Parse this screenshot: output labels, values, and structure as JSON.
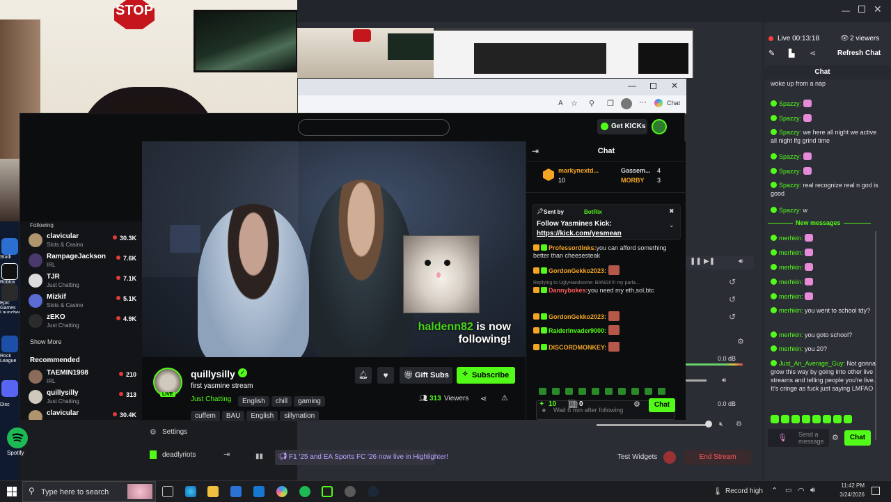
{
  "obs": {
    "live_time": "Live 00:13:18",
    "viewers": "2 viewers",
    "refresh_chat": "Refresh Chat",
    "chat_title": "Chat",
    "new_messages": "New messages",
    "test_widgets": "Test Widgets",
    "end_stream": "End Stream",
    "settings": "Settings",
    "account": "deadlyriots",
    "highlighter_banner": "F1 '25 and EA Sports FC '26 now live in Highlighter!",
    "db_values": [
      "0.0 dB",
      "0.0 dB",
      "0.0 dB"
    ],
    "send_placeholder": "Send a message",
    "chat_button": "Chat",
    "dock_messages": [
      {
        "user": "",
        "text": "woke up from a nap",
        "emote": false
      },
      {
        "user": "Spazzy:",
        "text": "",
        "emote": true
      },
      {
        "user": "Spazzy:",
        "text": "",
        "emote": true
      },
      {
        "user": "Spazzy:",
        "text": "we here all night we active all night lfg grind time",
        "emote": false
      },
      {
        "user": "Spazzy:",
        "text": "",
        "emote": true
      },
      {
        "user": "Spazzy:",
        "text": "",
        "emote": true
      },
      {
        "user": "Spazzy:",
        "text": "real recognize real n god is good",
        "emote": false
      },
      {
        "user": "Spazzy:",
        "text": "w",
        "emote": false
      }
    ],
    "dock_new": [
      {
        "user": "merhkin:",
        "text": "",
        "emote": true
      },
      {
        "user": "merhkin:",
        "text": "",
        "emote": true
      },
      {
        "user": "merhkin:",
        "text": "",
        "emote": true
      },
      {
        "user": "merhkin:",
        "text": "",
        "emote": true
      },
      {
        "user": "merhkin:",
        "text": "",
        "emote": true
      },
      {
        "user": "merhkin:",
        "text": "you went to school tdy?",
        "emote": false
      },
      {
        "user": "merhkin:",
        "text": "you goto school?",
        "emote": false
      },
      {
        "user": "merhkin:",
        "text": "you 20?",
        "emote": false
      },
      {
        "user": "Just_An_Average_Guy:",
        "text": "Not gonna grow this way by going into other live streams and telling people you're live. It's cringe as fuck just saying LMFAO",
        "emote": false
      }
    ]
  },
  "desktop": {
    "icons": [
      "Studi",
      "Roblox",
      "Epic Games Launcher",
      "Rock League",
      "Disc",
      "Spotify"
    ],
    "stop_sign": "STOP"
  },
  "browser": {
    "chat_label": "Chat"
  },
  "kick": {
    "get_kicks": "Get KICKs",
    "following_label": "Following",
    "following": [
      {
        "name": "clavicular",
        "cat": "Slots & Casino",
        "count": "30.3K"
      },
      {
        "name": "RampageJackson",
        "cat": "IRL",
        "count": "7.6K"
      },
      {
        "name": "TJR",
        "cat": "Just Chatting",
        "count": "7.1K"
      },
      {
        "name": "Mizkif",
        "cat": "Slots & Casino",
        "count": "5.1K"
      },
      {
        "name": "zEKO",
        "cat": "Just Chatting",
        "count": "4.9K"
      }
    ],
    "show_more": "Show More",
    "recommended_label": "Recommended",
    "recommended": [
      {
        "name": "TAEMIN1998",
        "cat": "IRL",
        "count": "210"
      },
      {
        "name": "quillysilly",
        "cat": "Just Chatting",
        "count": "313"
      },
      {
        "name": "clavicular",
        "cat": "",
        "count": "30.4K"
      }
    ],
    "follow_user": "haldenn82",
    "follow_text": "is now following!",
    "streamer": "quillysilly",
    "stream_title": "first yasmine stream",
    "category": "Just Chatting",
    "tags1": [
      "English",
      "chill",
      "gaming"
    ],
    "tags2": [
      "cuffem",
      "BAU",
      "English",
      "sillynation"
    ],
    "live_badge": "LIVE",
    "gift_subs": "Gift Subs",
    "subscribe": "Subscribe",
    "viewers_count": "313",
    "viewers_label": "Viewers",
    "chat_title": "Chat",
    "leaderboard": [
      {
        "name": "markynextd...",
        "count": "10"
      },
      {
        "name": "Gassem...",
        "count": "4"
      },
      {
        "name": "MORBY",
        "count": "3"
      }
    ],
    "pinned_by": "Sent by",
    "pinned_user": "BotRix",
    "pinned_text": "Follow Yasmines Kick:",
    "pinned_link": "https://kick.com/yesmean",
    "messages": [
      {
        "user": "Professordinks:",
        "text": "you can afford something better than cheesesteak",
        "color": "#f5a524"
      },
      {
        "user": "GordonGekko2023:",
        "text": "",
        "color": "#f5a524"
      },
      {
        "user": "Dannybokes:",
        "text": "you need my eth,sol,btc",
        "color": "#ff5b5b",
        "reply": "Replying to UglyHandsome: BANG!!!!! my parla..."
      },
      {
        "user": "GordonGekko2023:",
        "text": "",
        "color": "#f5a524"
      },
      {
        "user": "RaiderInvader9000:",
        "text": "",
        "color": "#53fc18"
      },
      {
        "user": "DISCORDMONKEY:",
        "text": "",
        "color": "#f5a524"
      }
    ],
    "chat_placeholder": "Wait 6 min after following",
    "points": "10",
    "bits": "0",
    "chat_button": "Chat"
  },
  "taskbar": {
    "search_placeholder": "Type here to search",
    "record": "Record high",
    "time": "11:42 PM",
    "date": "3/24/2026"
  }
}
